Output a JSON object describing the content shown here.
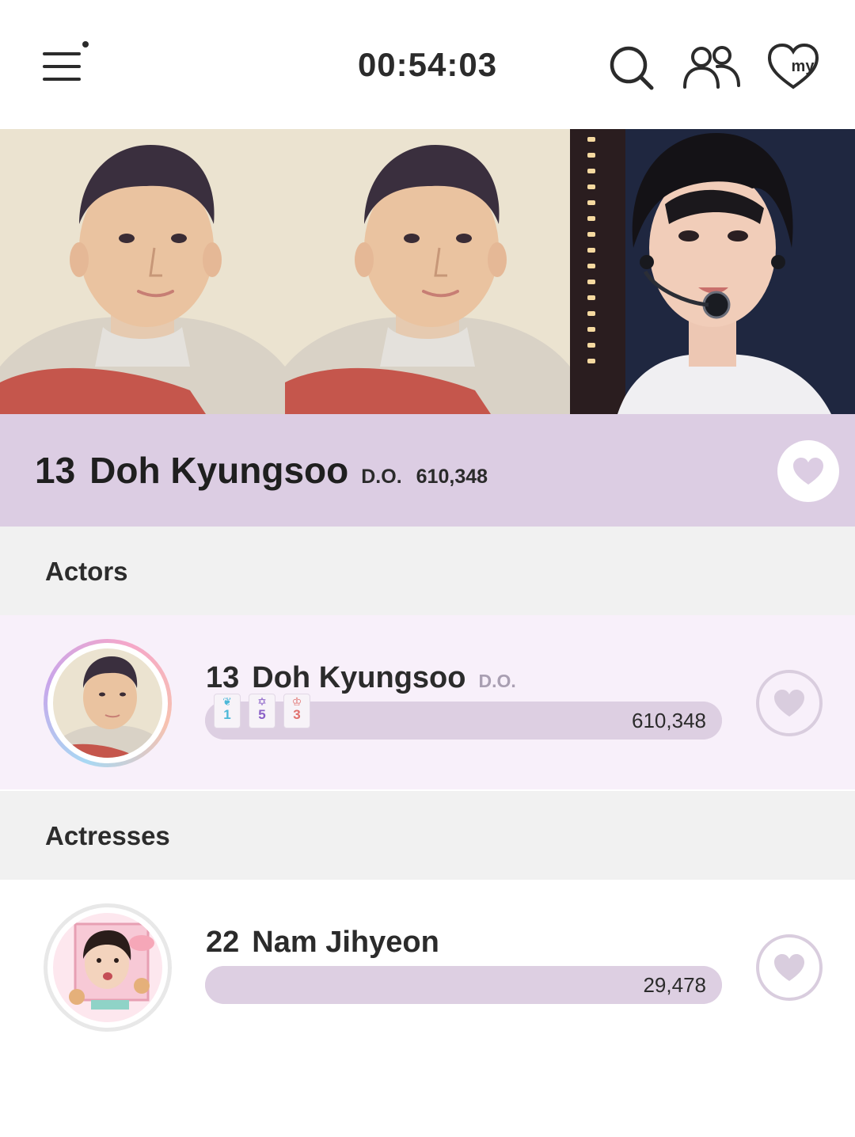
{
  "header": {
    "timer": "00:54:03",
    "icons": [
      "menu-icon",
      "search-icon",
      "people-icon",
      "my-heart-icon"
    ],
    "my_label": "my"
  },
  "banner": {
    "photos": [
      "child-portrait-photo",
      "child-portrait-photo",
      "stage-performer-photo"
    ]
  },
  "featured": {
    "rank": "13",
    "name": "Doh Kyungsoo",
    "alias": "D.O.",
    "votes": "610,348"
  },
  "sections": [
    {
      "title": "Actors",
      "entries": [
        {
          "rank": "13",
          "name": "Doh Kyungsoo",
          "alias": "D.O.",
          "votes": "610,348",
          "vote_fill_pct": 100,
          "badges": [
            {
              "icon": "wing-icon",
              "count": "1",
              "color": "#4cb8d8"
            },
            {
              "icon": "star-icon",
              "count": "5",
              "color": "#8a5fc7"
            },
            {
              "icon": "crown-icon",
              "count": "3",
              "color": "#e0706d"
            }
          ]
        }
      ]
    },
    {
      "title": "Actresses",
      "entries": [
        {
          "rank": "22",
          "name": "Nam Jihyeon",
          "alias": "",
          "votes": "29,478",
          "vote_fill_pct": 100,
          "badges": []
        }
      ]
    }
  ],
  "colors": {
    "accent_lavender": "#dccde3",
    "row_highlight": "#f8f0fa",
    "section_bg": "#f1f1f1",
    "heart_outline": "#d9cdde"
  }
}
